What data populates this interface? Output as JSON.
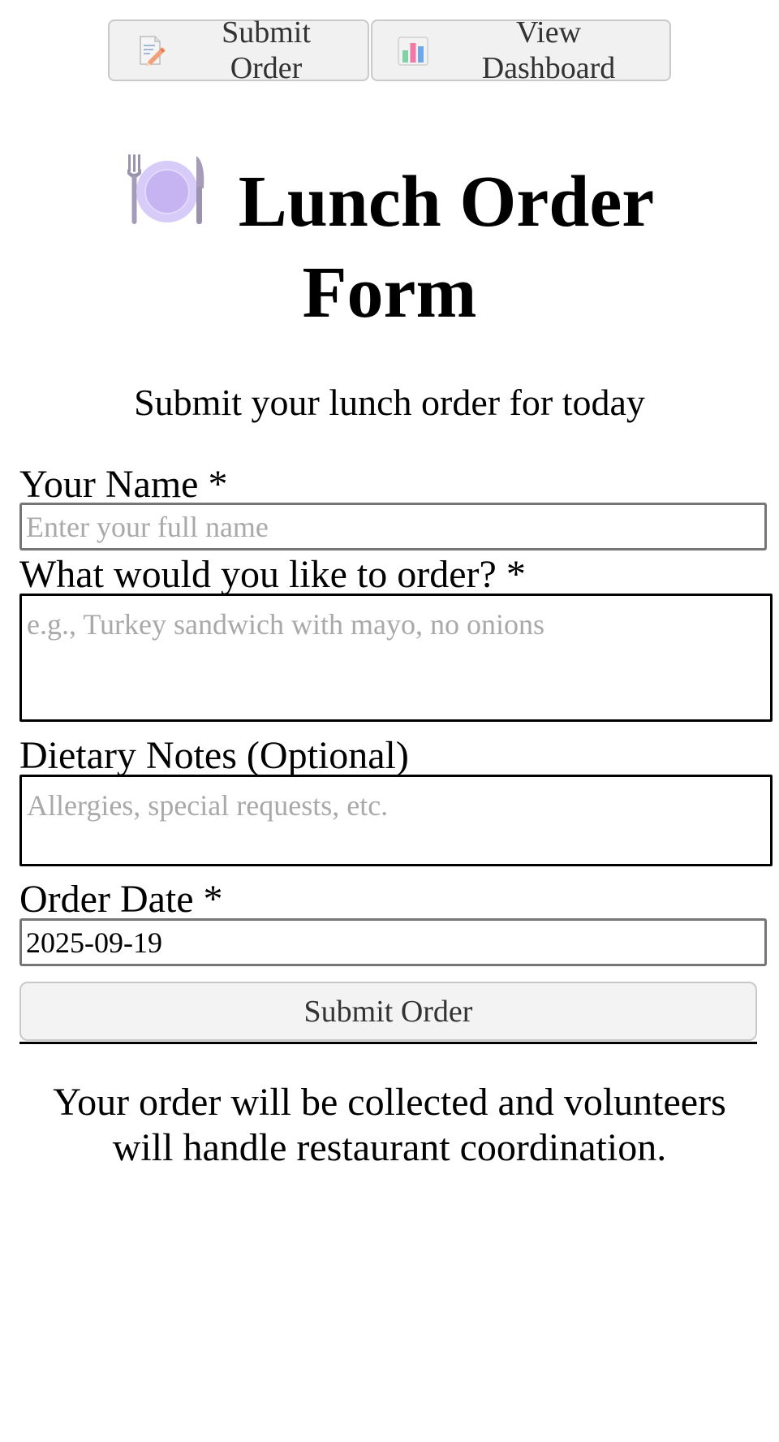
{
  "nav": {
    "submit_label": "Submit Order",
    "submit_icon": "memo-icon",
    "dashboard_label": "View Dashboard",
    "dashboard_icon": "bar-chart-icon"
  },
  "header": {
    "title": "Lunch Order Form",
    "title_icon": "fork-knife-plate-icon",
    "subtitle": "Submit your lunch order for today"
  },
  "form": {
    "name": {
      "label": "Your Name *",
      "placeholder": "Enter your full name",
      "value": ""
    },
    "order": {
      "label": "What would you like to order? *",
      "placeholder": "e.g., Turkey sandwich with mayo, no onions",
      "value": ""
    },
    "dietary": {
      "label": "Dietary Notes (Optional)",
      "placeholder": "Allergies, special requests, etc.",
      "value": ""
    },
    "date": {
      "label": "Order Date *",
      "value": "2025-09-19"
    },
    "submit_label": "Submit Order"
  },
  "footer": {
    "note": "Your order will be collected and volunteers will handle restaurant coordination."
  },
  "colors": {
    "button_bg": "#f1f1f1",
    "button_border": "#c9c9c9",
    "placeholder": "#a9a9a9",
    "plate_purple": "#cdbdf5",
    "cutlery_gray": "#9b92ad"
  }
}
